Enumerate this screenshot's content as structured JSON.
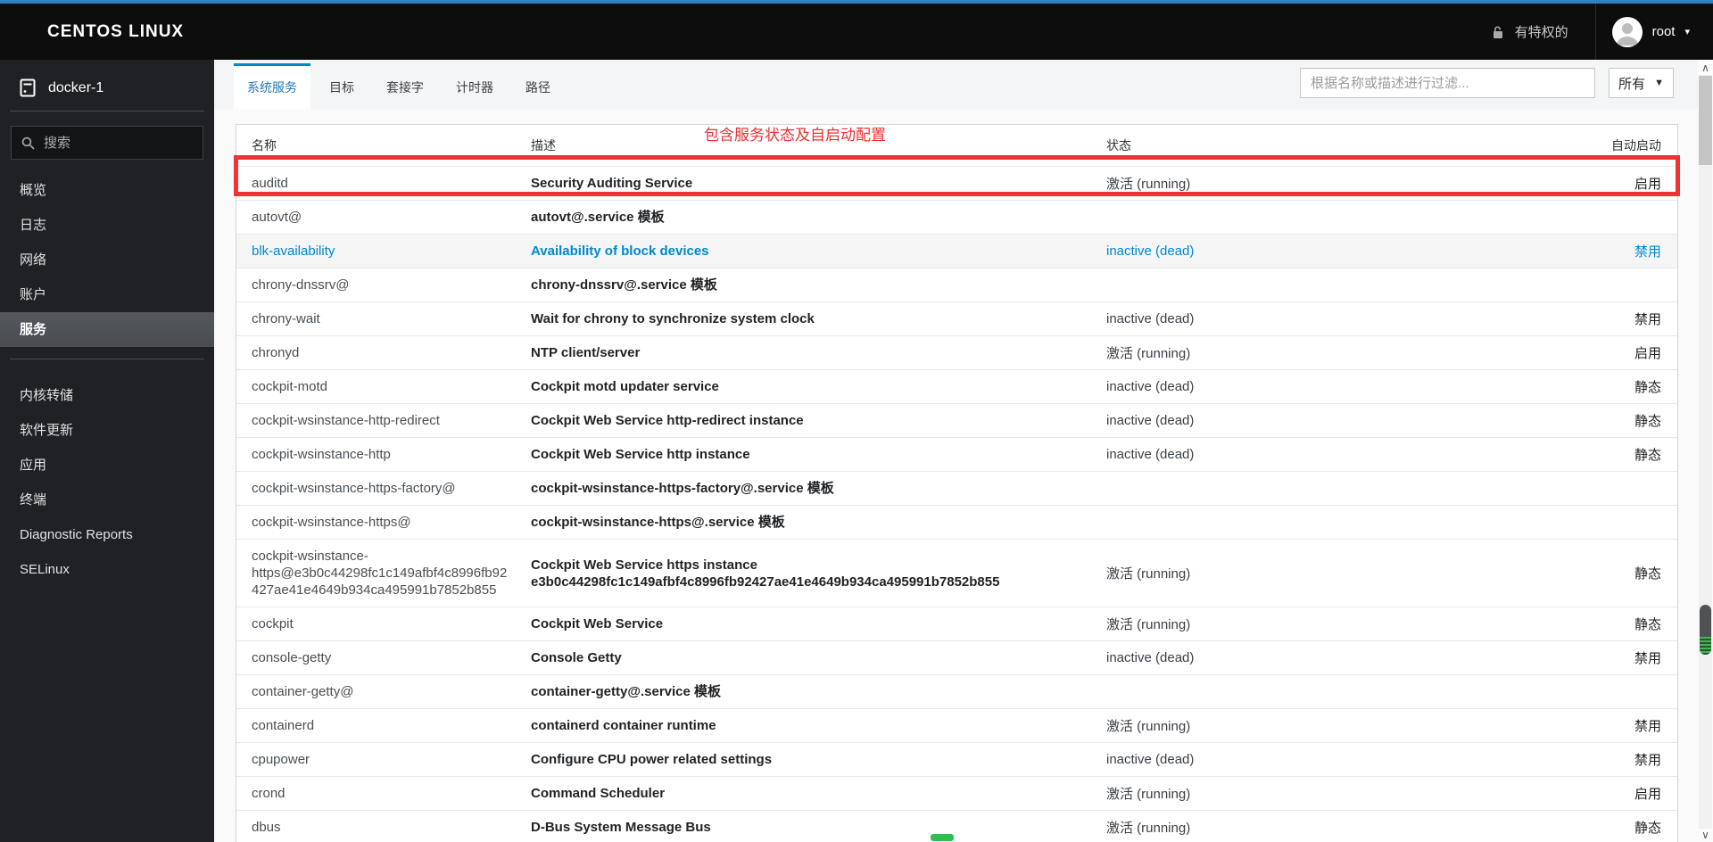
{
  "masthead": {
    "brand": "CENTOS LINUX",
    "privileged_label": "有特权的",
    "user": "root"
  },
  "sidebar": {
    "host": "docker-1",
    "search_placeholder": "搜索",
    "primary_items": [
      {
        "key": "overview",
        "label": "概览",
        "active": false
      },
      {
        "key": "logs",
        "label": "日志",
        "active": false
      },
      {
        "key": "networking",
        "label": "网络",
        "active": false
      },
      {
        "key": "accounts",
        "label": "账户",
        "active": false
      },
      {
        "key": "services",
        "label": "服务",
        "active": true
      }
    ],
    "secondary_items": [
      {
        "key": "kernel-dumps",
        "label": "内核转储"
      },
      {
        "key": "software-updates",
        "label": "软件更新"
      },
      {
        "key": "applications",
        "label": "应用"
      },
      {
        "key": "terminal",
        "label": "终端"
      },
      {
        "key": "diagnostic-reports",
        "label": "Diagnostic Reports"
      },
      {
        "key": "selinux",
        "label": "SELinux"
      }
    ]
  },
  "tabs": [
    {
      "key": "system-services",
      "label": "系统服务",
      "active": true
    },
    {
      "key": "targets",
      "label": "目标",
      "active": false
    },
    {
      "key": "sockets",
      "label": "套接字",
      "active": false
    },
    {
      "key": "timers",
      "label": "计时器",
      "active": false
    },
    {
      "key": "paths",
      "label": "路径",
      "active": false
    }
  ],
  "toolbar": {
    "filter_placeholder": "根据名称或描述进行过滤...",
    "scope_dropdown_value": "所有"
  },
  "annotation": {
    "label": "包含服务状态及自启动配置",
    "color": "#ee2f35"
  },
  "services_table": {
    "columns": {
      "name": "名称",
      "description": "描述",
      "state": "状态",
      "autostart": "自动启动"
    },
    "rows": [
      {
        "name": "auditd",
        "description": "Security Auditing Service",
        "state": "激活 (running)",
        "autostart": "启用",
        "highlighted": true,
        "hovered": false
      },
      {
        "name": "autovt@",
        "description": "autovt@.service 模板",
        "state": "",
        "autostart": "",
        "highlighted": false,
        "hovered": false
      },
      {
        "name": "blk-availability",
        "description": "Availability of block devices",
        "state": "inactive (dead)",
        "autostart": "禁用",
        "highlighted": false,
        "hovered": true
      },
      {
        "name": "chrony-dnssrv@",
        "description": "chrony-dnssrv@.service 模板",
        "state": "",
        "autostart": "",
        "highlighted": false,
        "hovered": false
      },
      {
        "name": "chrony-wait",
        "description": "Wait for chrony to synchronize system clock",
        "state": "inactive (dead)",
        "autostart": "禁用",
        "highlighted": false,
        "hovered": false
      },
      {
        "name": "chronyd",
        "description": "NTP client/server",
        "state": "激活 (running)",
        "autostart": "启用",
        "highlighted": false,
        "hovered": false
      },
      {
        "name": "cockpit-motd",
        "description": "Cockpit motd updater service",
        "state": "inactive (dead)",
        "autostart": "静态",
        "highlighted": false,
        "hovered": false
      },
      {
        "name": "cockpit-wsinstance-http-redirect",
        "description": "Cockpit Web Service http-redirect instance",
        "state": "inactive (dead)",
        "autostart": "静态",
        "highlighted": false,
        "hovered": false
      },
      {
        "name": "cockpit-wsinstance-http",
        "description": "Cockpit Web Service http instance",
        "state": "inactive (dead)",
        "autostart": "静态",
        "highlighted": false,
        "hovered": false
      },
      {
        "name": "cockpit-wsinstance-https-factory@",
        "description": "cockpit-wsinstance-https-factory@.service 模板",
        "state": "",
        "autostart": "",
        "highlighted": false,
        "hovered": false
      },
      {
        "name": "cockpit-wsinstance-https@",
        "description": "cockpit-wsinstance-https@.service 模板",
        "state": "",
        "autostart": "",
        "highlighted": false,
        "hovered": false
      },
      {
        "name": "cockpit-wsinstance-https@e3b0c44298fc1c149afbf4c8996fb92427ae41e4649b934ca495991b7852b855",
        "description": "Cockpit Web Service https instance e3b0c44298fc1c149afbf4c8996fb92427ae41e4649b934ca495991b7852b855",
        "state": "激活 (running)",
        "autostart": "静态",
        "highlighted": false,
        "hovered": false
      },
      {
        "name": "cockpit",
        "description": "Cockpit Web Service",
        "state": "激活 (running)",
        "autostart": "静态",
        "highlighted": false,
        "hovered": false
      },
      {
        "name": "console-getty",
        "description": "Console Getty",
        "state": "inactive (dead)",
        "autostart": "禁用",
        "highlighted": false,
        "hovered": false
      },
      {
        "name": "container-getty@",
        "description": "container-getty@.service 模板",
        "state": "",
        "autostart": "",
        "highlighted": false,
        "hovered": false
      },
      {
        "name": "containerd",
        "description": "containerd container runtime",
        "state": "激活 (running)",
        "autostart": "禁用",
        "highlighted": false,
        "hovered": false
      },
      {
        "name": "cpupower",
        "description": "Configure CPU power related settings",
        "state": "inactive (dead)",
        "autostart": "禁用",
        "highlighted": false,
        "hovered": false
      },
      {
        "name": "crond",
        "description": "Command Scheduler",
        "state": "激活 (running)",
        "autostart": "启用",
        "highlighted": false,
        "hovered": false
      },
      {
        "name": "dbus",
        "description": "D-Bus System Message Bus",
        "state": "激活 (running)",
        "autostart": "静态",
        "highlighted": false,
        "hovered": false
      }
    ]
  },
  "icons": {
    "masthead_lock": "unlocked-padlock",
    "avatar": "person-silhouette",
    "host": "server",
    "sidebar_search": "magnifier",
    "carets": "caret-down",
    "scroll_arrows": "chevron-up-down"
  },
  "colors": {
    "accent_blue": "#0088ce",
    "annotation_red": "#ee2f35",
    "marker_green": "#2fbf4f",
    "masthead_bg": "#0d0d0d",
    "sidebar_bg": "#1f2124"
  }
}
